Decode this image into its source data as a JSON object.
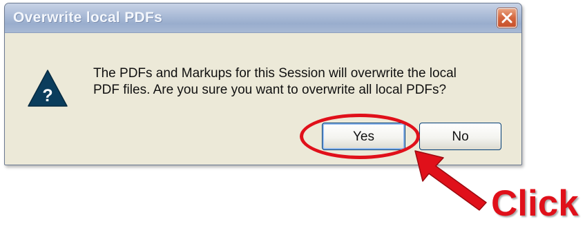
{
  "dialog": {
    "title": "Overwrite local PDFs",
    "close_icon": "close-icon",
    "icon": "question-warning-icon",
    "message_lines": [
      "The PDFs and Markups for this Session will overwrite the local",
      "PDF files. Are you sure you want to overwrite all local PDFs?"
    ],
    "buttons": {
      "yes_label": "Yes",
      "no_label": "No"
    }
  },
  "annotation": {
    "label": "Click",
    "color": "#e0101a",
    "arrow_icon": "red-arrow-icon"
  },
  "colors": {
    "titlebar": "#a9bad6",
    "dialog_bg": "#ece9d8",
    "close_button": "#d3663f",
    "icon_triangle": "#0b3d5c"
  }
}
